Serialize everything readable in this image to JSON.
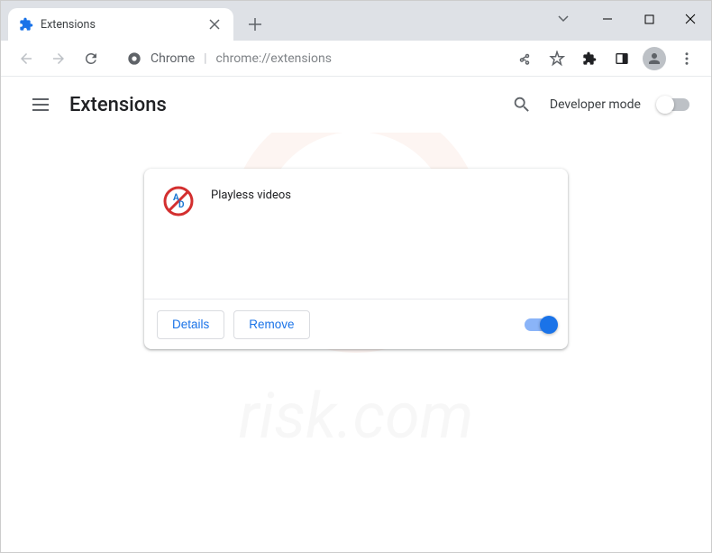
{
  "tab": {
    "title": "Extensions"
  },
  "omnibox": {
    "label": "Chrome",
    "url": "chrome://extensions"
  },
  "page": {
    "title": "Extensions",
    "dev_mode_label": "Developer mode"
  },
  "extension": {
    "name": "Playless videos",
    "details_label": "Details",
    "remove_label": "Remove"
  },
  "watermark": {
    "text": "risk.com"
  }
}
